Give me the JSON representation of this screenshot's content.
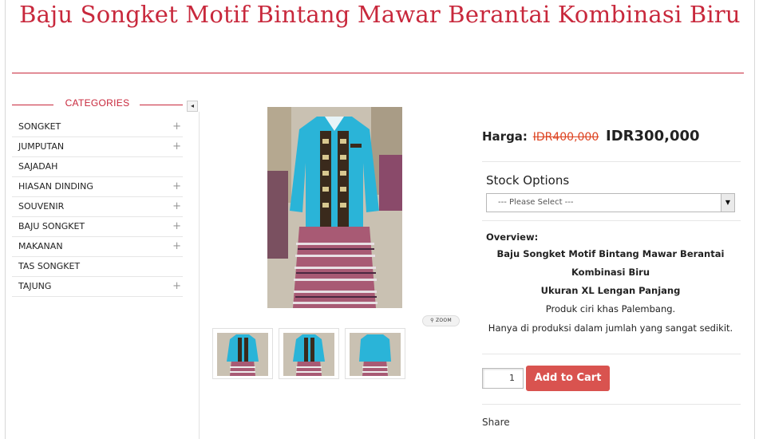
{
  "product": {
    "title": "Baju Songket Motif Bintang Mawar Berantai Kombinasi Biru",
    "price_label": "Harga:",
    "old_price": "IDR400,000",
    "new_price": "IDR300,000"
  },
  "sidebar": {
    "heading": "CATEGORIES",
    "collapse_icon": "◂",
    "items": [
      {
        "label": "SONGKET",
        "expandable": true
      },
      {
        "label": "JUMPUTAN",
        "expandable": true
      },
      {
        "label": "SAJADAH",
        "expandable": false
      },
      {
        "label": "HIASAN DINDING",
        "expandable": true
      },
      {
        "label": "SOUVENIR",
        "expandable": true
      },
      {
        "label": "BAJU SONGKET",
        "expandable": true
      },
      {
        "label": "MAKANAN",
        "expandable": true
      },
      {
        "label": "TAS SONGKET",
        "expandable": false
      },
      {
        "label": "TAJUNG",
        "expandable": true
      }
    ],
    "expand_icon": "+"
  },
  "gallery": {
    "zoom_label": "ZOOM",
    "thumbnail_count": 3
  },
  "options": {
    "stock_label": "Stock Options",
    "select_value": "--- Please Select ---"
  },
  "overview": {
    "heading": "Overview:",
    "line1": "Baju Songket Motif Bintang Mawar Berantai",
    "line2": "Kombinasi Biru",
    "line3": "Ukuran XL Lengan Panjang",
    "line4": "Produk ciri khas Palembang.",
    "line5": "Hanya di produksi dalam jumlah yang sangat sedikit."
  },
  "cart": {
    "quantity": "1",
    "button_label": "Add to Cart"
  },
  "share_label": "Share",
  "colors": {
    "accent": "#c8283c",
    "cart_button": "#d9534f",
    "garment_blue": "#2ab4d8"
  }
}
